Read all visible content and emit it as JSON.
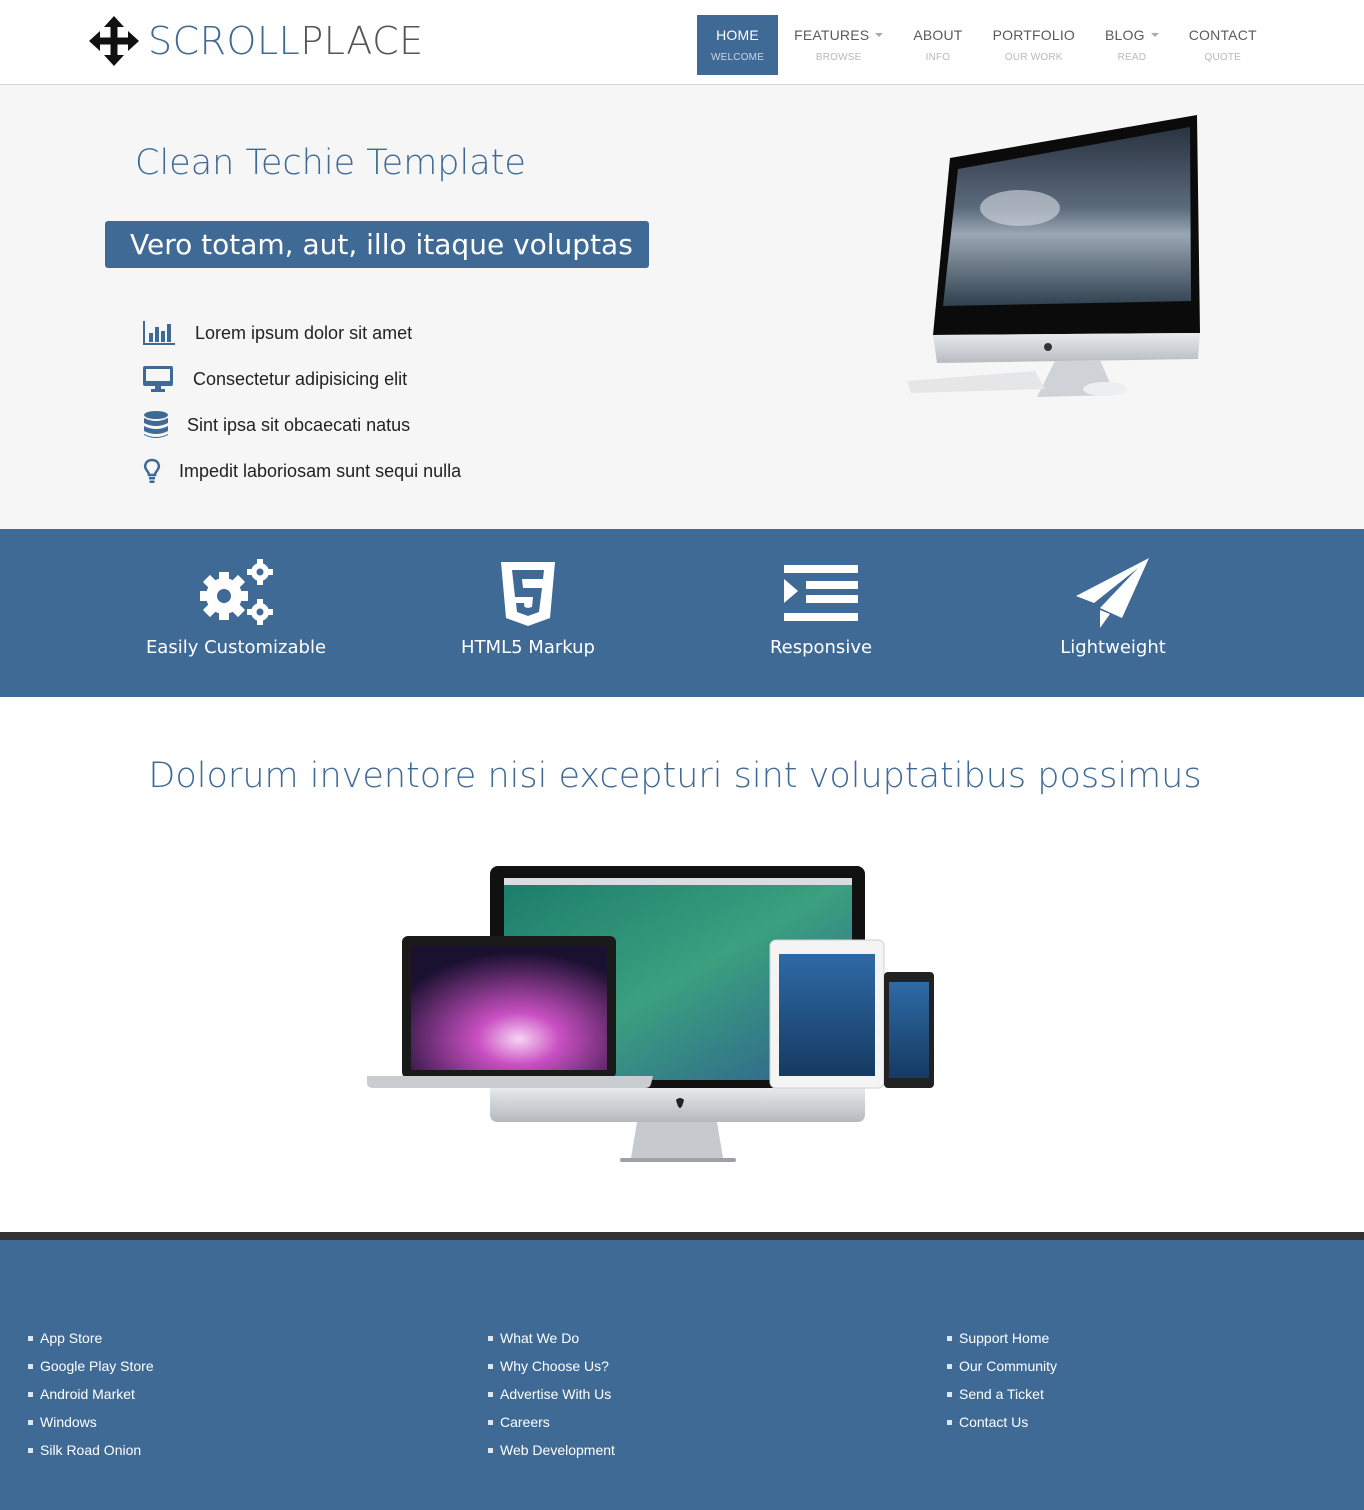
{
  "brand": {
    "part1": "SCROLL",
    "part2": "PLACE",
    "icon": "move-arrows-icon"
  },
  "nav": [
    {
      "label": "HOME",
      "sub": "WELCOME",
      "active": true,
      "dropdown": false
    },
    {
      "label": "FEATURES",
      "sub": "BROWSE",
      "active": false,
      "dropdown": true
    },
    {
      "label": "ABOUT",
      "sub": "INFO",
      "active": false,
      "dropdown": false
    },
    {
      "label": "PORTFOLIO",
      "sub": "OUR WORK",
      "active": false,
      "dropdown": false
    },
    {
      "label": "BLOG",
      "sub": "READ",
      "active": false,
      "dropdown": true
    },
    {
      "label": "CONTACT",
      "sub": "QUOTE",
      "active": false,
      "dropdown": false
    }
  ],
  "hero": {
    "title": "Clean Techie Template",
    "badge": "Vero totam, aut, illo itaque voluptas",
    "items": [
      {
        "icon": "bar-chart-icon",
        "text": "Lorem ipsum dolor sit amet"
      },
      {
        "icon": "desktop-icon",
        "text": "Consectetur adipisicing elit"
      },
      {
        "icon": "database-icon",
        "text": "Sint ipsa sit obcaecati natus"
      },
      {
        "icon": "lightbulb-icon",
        "text": "Impedit laboriosam sunt sequi nulla"
      }
    ]
  },
  "features": [
    {
      "icon": "gears-icon",
      "label": "Easily Customizable"
    },
    {
      "icon": "html5-icon",
      "label": "HTML5 Markup"
    },
    {
      "icon": "indent-icon",
      "label": "Responsive"
    },
    {
      "icon": "paper-plane-icon",
      "label": "Lightweight"
    }
  ],
  "section": {
    "title": "Dolorum inventore nisi excepturi sint voluptatibus possimus"
  },
  "footer": {
    "col1": [
      "App Store",
      "Google Play Store",
      "Android Market",
      "Windows",
      "Silk Road Onion"
    ],
    "col2": [
      "What We Do",
      "Why Choose Us?",
      "Advertise With Us",
      "Careers",
      "Web Development"
    ],
    "col3": [
      "Support Home",
      "Our Community",
      "Send a Ticket",
      "Contact Us"
    ]
  },
  "colors": {
    "accent": "#3f6a96",
    "hero_bg": "#f6f6f6",
    "footer_border": "#333333"
  }
}
